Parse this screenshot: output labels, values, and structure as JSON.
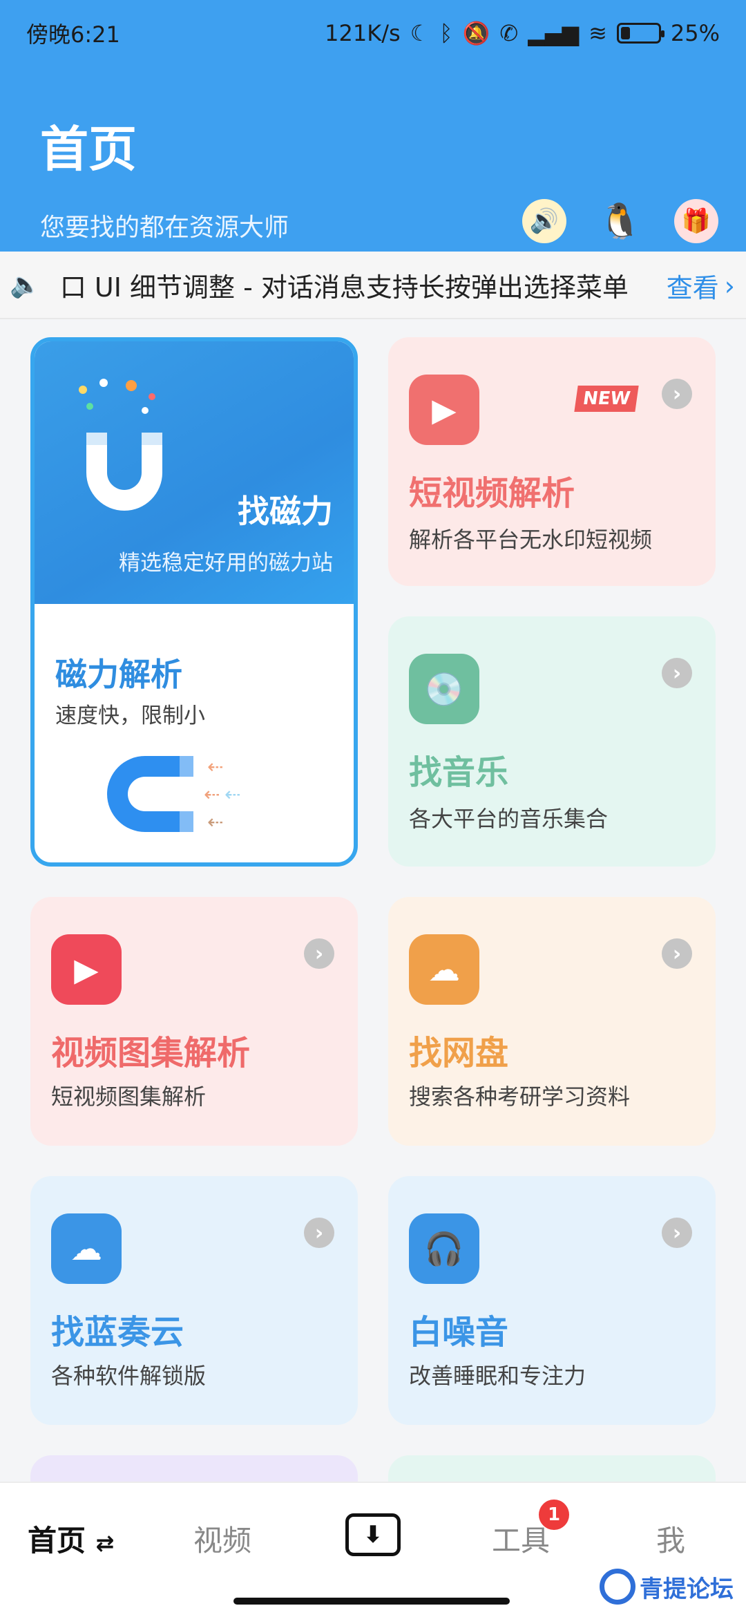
{
  "status_bar": {
    "time": "傍晚6:21",
    "net_speed": "121K/s",
    "battery_text": "25%",
    "battery_level": 0.25
  },
  "header": {
    "title": "首页",
    "subtitle": "您要找的都在资源大师",
    "icons": [
      "speaker-icon",
      "qq-penguin-icon",
      "gift-icon"
    ]
  },
  "notice": {
    "text": "口 UI 细节调整   - 对话消息支持长按弹出选择菜单",
    "more_label": "查看"
  },
  "magnet_card": {
    "top_title": "找磁力",
    "top_desc": "精选稳定好用的磁力站",
    "bottom_title": "磁力解析",
    "bottom_desc": "速度快，限制小"
  },
  "cards": {
    "short_video": {
      "title": "短视频解析",
      "desc": "解析各平台无水印短视频",
      "badge": "NEW",
      "color": "#f0706f",
      "bg": "#fde9e8"
    },
    "music": {
      "title": "找音乐",
      "desc": "各大平台的音乐集合",
      "color": "#6fbf9f",
      "bg": "#e4f6f1"
    },
    "gallery": {
      "title": "视频图集解析",
      "desc": "短视频图集解析",
      "color": "#ef6a6a",
      "bg": "#fdeaea"
    },
    "netdisk": {
      "title": "找网盘",
      "desc": "搜索各种考研学习资料",
      "color": "#f0a04a",
      "bg": "#fdf2e7"
    },
    "lanzou": {
      "title": "找蓝奏云",
      "desc": "各种软件解锁版",
      "color": "#3b95e6",
      "bg": "#e5f2fc"
    },
    "white_noise": {
      "title": "白噪音",
      "desc": "改善睡眠和专注力",
      "color": "#3b95e6",
      "bg": "#e5f2fc"
    }
  },
  "bottom_nav": {
    "home": "首页",
    "video": "视频",
    "tools": "工具",
    "tools_badge": "1",
    "me": "我"
  },
  "watermark": "青提论坛"
}
